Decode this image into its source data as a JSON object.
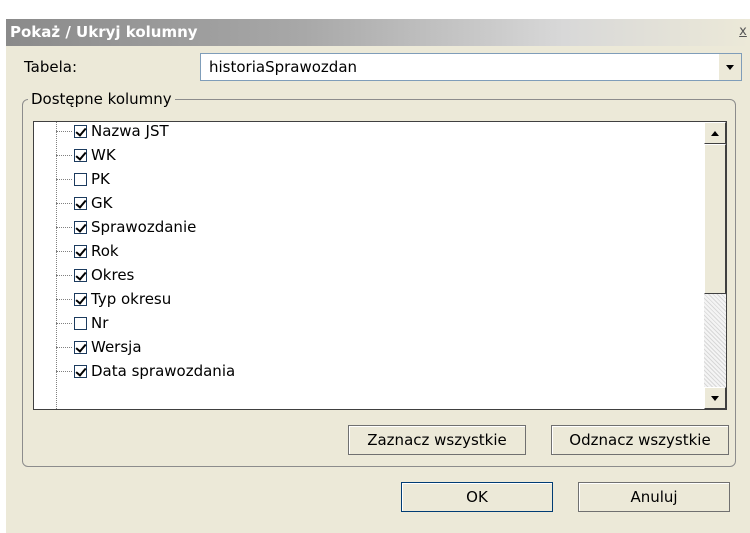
{
  "dialog": {
    "title": "Pokaż / Ukryj kolumny",
    "close_label": "x"
  },
  "table_field": {
    "label": "Tabela:",
    "value": "historiaSprawozdan"
  },
  "columns_group": {
    "legend": "Dostępne kolumny",
    "items": [
      {
        "label": "Nazwa JST",
        "checked": true
      },
      {
        "label": "WK",
        "checked": true
      },
      {
        "label": "PK",
        "checked": false
      },
      {
        "label": "GK",
        "checked": true
      },
      {
        "label": "Sprawozdanie",
        "checked": true
      },
      {
        "label": "Rok",
        "checked": true
      },
      {
        "label": "Okres",
        "checked": true
      },
      {
        "label": "Typ okresu",
        "checked": true
      },
      {
        "label": "Nr",
        "checked": false
      },
      {
        "label": "Wersja",
        "checked": true
      },
      {
        "label": "Data sprawozdania",
        "checked": true
      }
    ],
    "select_all_label": "Zaznacz wszystkie",
    "deselect_all_label": "Odznacz wszystkie"
  },
  "footer": {
    "ok_label": "OK",
    "cancel_label": "Anuluj"
  },
  "colors": {
    "dialog_bg": "#ece9d8",
    "list_border": "#404040"
  }
}
